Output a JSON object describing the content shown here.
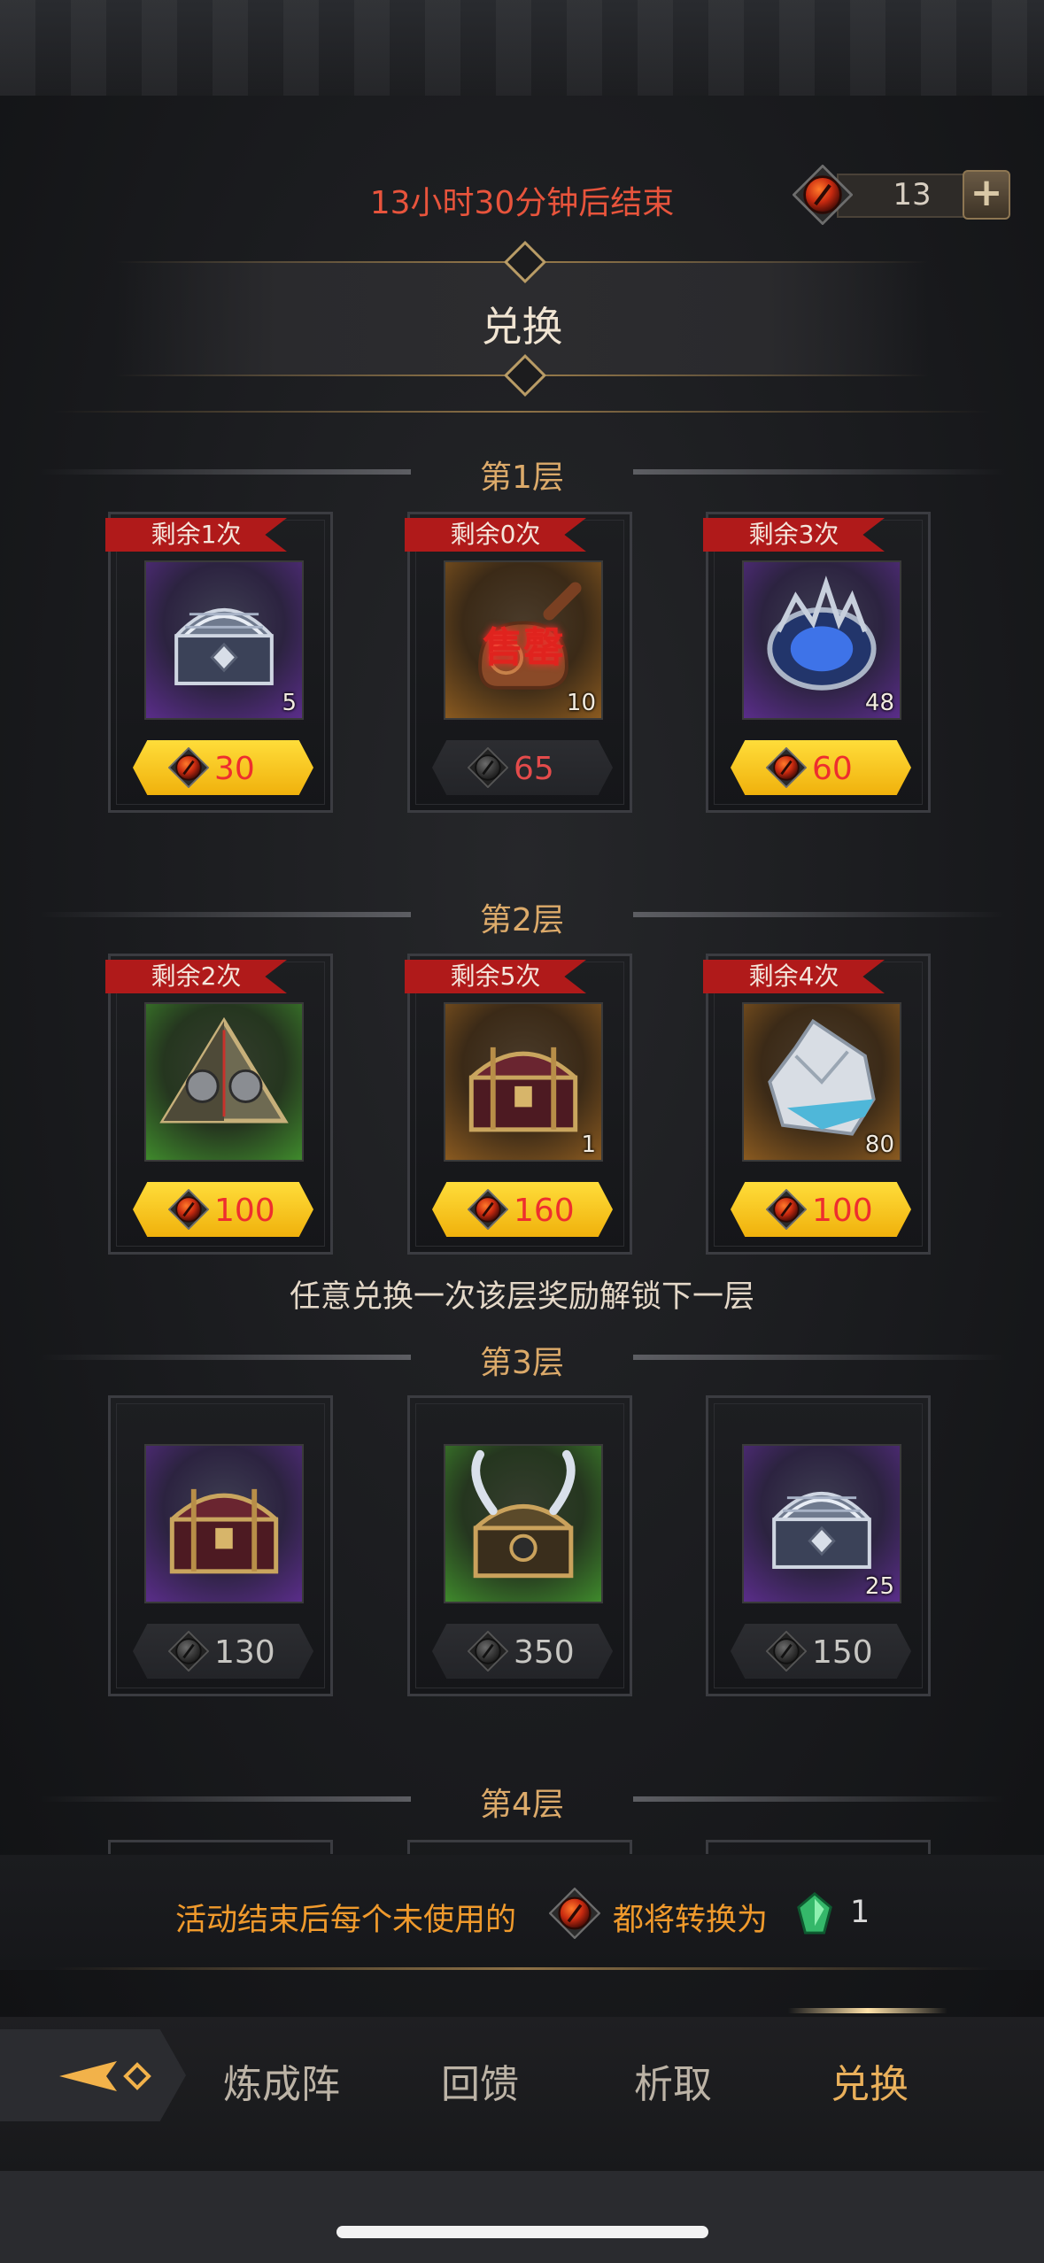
{
  "header": {
    "timer_text": "13小时30分钟后结束",
    "currency_count": "13",
    "plus_label": "+",
    "title": "兑换"
  },
  "tiers": [
    {
      "label": "第1层",
      "items": [
        {
          "remaining": "剩余1次",
          "qty": "5",
          "price": "30",
          "price_style": "gold",
          "icon": "silver-chest-icon"
        },
        {
          "remaining": "剩余0次",
          "qty": "10",
          "price": "65",
          "price_style": "grey-red",
          "icon": "scroll-icon",
          "sold_out": "售罄"
        },
        {
          "remaining": "剩余3次",
          "qty": "48",
          "price": "60",
          "price_style": "gold",
          "icon": "blue-crystal-icon"
        }
      ]
    },
    {
      "label": "第2层",
      "items": [
        {
          "remaining": "剩余2次",
          "qty": "",
          "price": "100",
          "price_style": "gold",
          "icon": "pyramid-relic-icon"
        },
        {
          "remaining": "剩余5次",
          "qty": "1",
          "price": "160",
          "price_style": "gold",
          "icon": "gold-chest-icon"
        },
        {
          "remaining": "剩余4次",
          "qty": "80",
          "price": "100",
          "price_style": "gold",
          "icon": "ice-ore-icon"
        }
      ],
      "unlock_hint": "任意兑换一次该层奖励解锁下一层"
    },
    {
      "label": "第3层",
      "items": [
        {
          "remaining": "",
          "qty": "",
          "price": "130",
          "price_style": "grey",
          "icon": "gold-chest-icon"
        },
        {
          "remaining": "",
          "qty": "",
          "price": "350",
          "price_style": "grey",
          "icon": "horned-chest-icon"
        },
        {
          "remaining": "",
          "qty": "25",
          "price": "150",
          "price_style": "grey",
          "icon": "silver-chest-icon"
        }
      ]
    },
    {
      "label": "第4层",
      "items": []
    }
  ],
  "conversion": {
    "text_before": "活动结束后每个未使用的",
    "text_after": "都将转换为",
    "value": "1"
  },
  "nav": {
    "tabs": [
      "炼成阵",
      "回馈",
      "析取",
      "兑换"
    ],
    "active": "兑换"
  },
  "colors": {
    "timer": "#e8543c",
    "tier_label": "#dcaa6a",
    "ribbon": "#b01a1a",
    "gold_button": "#f7c51f",
    "price_red": "#ee2e2e",
    "conversion_text": "#f09a2c",
    "nav_active": "#eab05b"
  }
}
